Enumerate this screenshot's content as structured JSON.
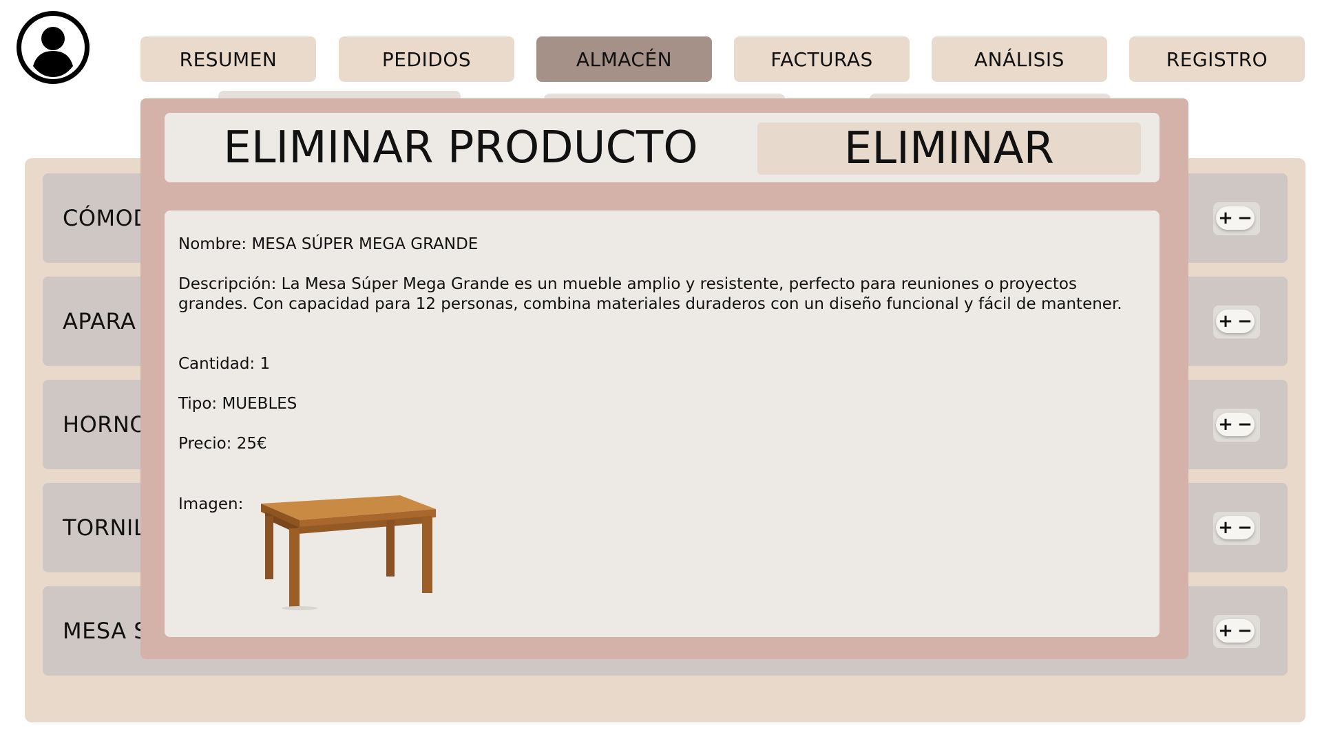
{
  "user": {
    "avatar_icon": "user-icon"
  },
  "nav": {
    "tabs": [
      {
        "label": "RESUMEN",
        "active": false
      },
      {
        "label": "PEDIDOS",
        "active": false
      },
      {
        "label": "ALMACÉN",
        "active": true
      },
      {
        "label": "FACTURAS",
        "active": false
      },
      {
        "label": "ANÁLISIS",
        "active": false
      },
      {
        "label": "REGISTRO",
        "active": false
      }
    ]
  },
  "inventory": {
    "rows": [
      {
        "label": "CÓMOD"
      },
      {
        "label": "APARA"
      },
      {
        "label": "HORNO"
      },
      {
        "label": "TORNIL"
      },
      {
        "label": "MESA S"
      }
    ],
    "stepper": {
      "plus": "+",
      "minus": "−"
    }
  },
  "modal": {
    "title": "ELIMINAR PRODUCTO",
    "delete_label": "ELIMINAR",
    "name_line": "Nombre: MESA SÚPER MEGA GRANDE",
    "description_line": "Descripción: La Mesa Súper Mega Grande es un mueble amplio y resistente, perfecto para reuniones o proyectos grandes. Con capacidad para 12 personas, combina materiales duraderos con un diseño funcional y fácil de mantener.",
    "quantity_line": "Cantidad: 1",
    "type_line": "Tipo: MUEBLES",
    "price_line": "Precio: 25€",
    "image_label": "Imagen:"
  },
  "colors": {
    "tab": "#e9dacb",
    "tab_active": "#a59188",
    "panel": "#e8d9cb",
    "row": "#cfc7c3",
    "modal_frame": "#d4b1a9",
    "modal_surface": "#edeae5"
  }
}
